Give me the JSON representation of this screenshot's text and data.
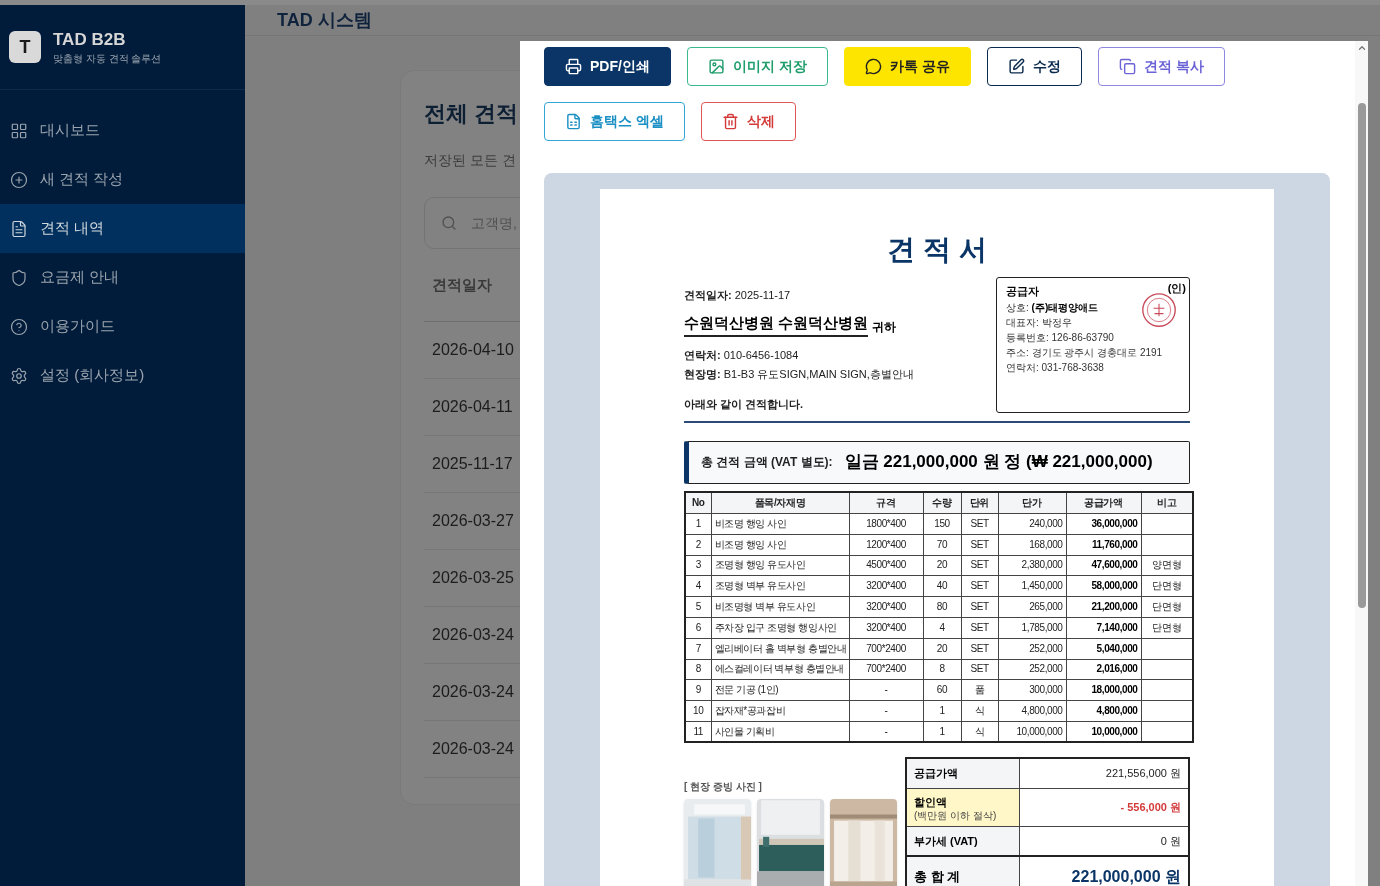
{
  "sidebar": {
    "logo_letter": "T",
    "brand": "TAD B2B",
    "tagline": "맞춤형 자동 견적 솔루션",
    "items": [
      {
        "label": "대시보드",
        "selected": false
      },
      {
        "label": "새 견적 작성",
        "selected": false
      },
      {
        "label": "견적 내역",
        "selected": true
      },
      {
        "label": "요금제 안내",
        "selected": false
      },
      {
        "label": "이용가이드",
        "selected": false
      },
      {
        "label": "설정 (회사정보)",
        "selected": false
      }
    ]
  },
  "header": {
    "title": "TAD 시스템"
  },
  "list_page": {
    "title": "전체 견적",
    "subtitle": "저장된 모든 견",
    "search": {
      "placeholder": "고객명,"
    },
    "column": "견적일자",
    "dates": [
      "2026-04-10",
      "2026-04-11",
      "2025-11-17",
      "2026-03-27",
      "2026-03-25",
      "2026-03-24",
      "2026-03-24",
      "2026-03-24"
    ]
  },
  "modal": {
    "buttons": [
      {
        "label": "PDF/인쇄",
        "kind": "primary"
      },
      {
        "label": "이미지 저장",
        "kind": "success"
      },
      {
        "label": "카톡 공유",
        "kind": "kakao"
      },
      {
        "label": "수정",
        "kind": "dark"
      },
      {
        "label": "견적 복사",
        "kind": "violet"
      },
      {
        "label": "홈택스 엑셀",
        "kind": "info"
      },
      {
        "label": "삭제",
        "kind": "danger"
      }
    ],
    "document": {
      "title": "견 적 서",
      "date_label": "견적일자:",
      "date": "2025-11-17",
      "client": "수원덕산병원 수원덕산병원",
      "honorific": "귀하",
      "contact_label": "연락처:",
      "contact": "010-6456-1084",
      "site_label": "현장명:",
      "site": "B1-B3 유도SIGN,MAIN SIGN,층별안내",
      "closing": "아래와 같이 견적합니다.",
      "supplier": {
        "heading": "공급자",
        "seal": "(인)",
        "lines": [
          {
            "label": "상호:",
            "value": "(주)태평양애드",
            "bold": true
          },
          {
            "label": "대표자:",
            "value": "박정우",
            "bold": false
          },
          {
            "label": "등록번호:",
            "value": "126-86-63790",
            "bold": false
          },
          {
            "label": "주소:",
            "value": "경기도 광주시 경충대로 2191",
            "bold": false
          },
          {
            "label": "연락처:",
            "value": "031-768-3638",
            "bold": false
          }
        ]
      },
      "total_label": "총 견적 금액 (VAT 별도):",
      "total_text": "일금 221,000,000 원 정 (₩ 221,000,000)",
      "columns": [
        "No",
        "품목/자재명",
        "규격",
        "수량",
        "단위",
        "단가",
        "공급가액",
        "비고"
      ],
      "rows": [
        [
          "1",
          "비조명 행잉 사인",
          "1800*400",
          "150",
          "SET",
          "240,000",
          "36,000,000",
          ""
        ],
        [
          "2",
          "비조명 행잉 사인",
          "1200*400",
          "70",
          "SET",
          "168,000",
          "11,760,000",
          ""
        ],
        [
          "3",
          "조명형 행잉 유도사인",
          "4500*400",
          "20",
          "SET",
          "2,380,000",
          "47,600,000",
          "양면형"
        ],
        [
          "4",
          "조명형 벽부 유도사인",
          "3200*400",
          "40",
          "SET",
          "1,450,000",
          "58,000,000",
          "단면형"
        ],
        [
          "5",
          "비조명형 벽부 유도사인",
          "3200*400",
          "80",
          "SET",
          "265,000",
          "21,200,000",
          "단면형"
        ],
        [
          "6",
          "주차장 입구 조명형 행잉사인",
          "3200*400",
          "4",
          "SET",
          "1,785,000",
          "7,140,000",
          "단면형"
        ],
        [
          "7",
          "엘리베이터 홀 벽부형 층별안내",
          "700*2400",
          "20",
          "SET",
          "252,000",
          "5,040,000",
          ""
        ],
        [
          "8",
          "에스컬레이터 벽부형 층별안내",
          "700*2400",
          "8",
          "SET",
          "252,000",
          "2,016,000",
          ""
        ],
        [
          "9",
          "전문 기공 (1인)",
          "-",
          "60",
          "품",
          "300,000",
          "18,000,000",
          ""
        ],
        [
          "10",
          "잡자재*공과잡비",
          "-",
          "1",
          "식",
          "4,800,000",
          "4,800,000",
          ""
        ],
        [
          "11",
          "사인물 기획비",
          "-",
          "1",
          "식",
          "10,000,000",
          "10,000,000",
          ""
        ]
      ],
      "photos_label": "[ 현장 증빙 사진 ]",
      "summary": [
        {
          "label": "공급가액",
          "value": "221,556,000 원",
          "kind": "normal"
        },
        {
          "label": "할인액",
          "note": "(백만원 이하 절삭)",
          "value": "- 556,000 원",
          "kind": "discount"
        },
        {
          "label": "부가세 (VAT)",
          "value": "0 원",
          "kind": "normal"
        },
        {
          "label": "총 합 계",
          "value": "221,000,000 원",
          "kind": "total"
        }
      ]
    }
  }
}
